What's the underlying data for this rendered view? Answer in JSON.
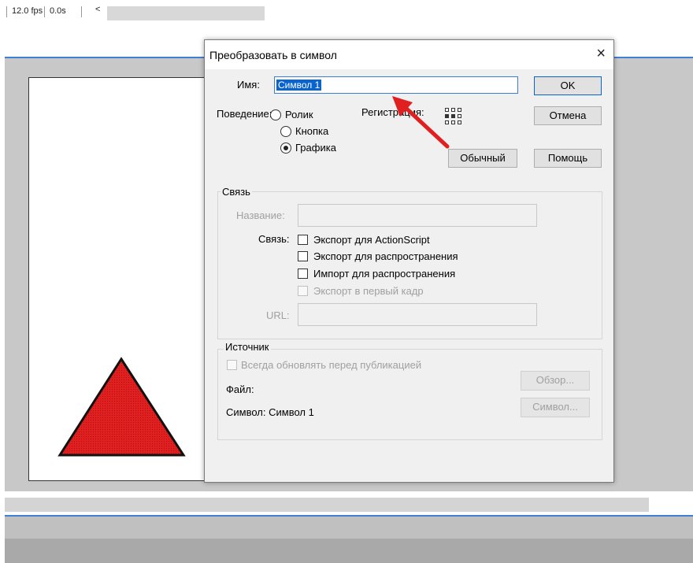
{
  "toolbar": {
    "fps": "12.0 fps",
    "time": "0.0s",
    "scroll_left": "<"
  },
  "dialog": {
    "title": "Преобразовать в символ",
    "close": "×",
    "name_label": "Имя:",
    "name_value": "Символ 1",
    "ok": "OK",
    "cancel": "Отмена",
    "behavior_label": "Поведение:",
    "behaviors": [
      {
        "label": "Ролик",
        "selected": false
      },
      {
        "label": "Кнопка",
        "selected": false
      },
      {
        "label": "Графика",
        "selected": true
      }
    ],
    "registration_label": "Регистрация:",
    "default_btn": "Обычный",
    "help_btn": "Помощь",
    "linkage": {
      "group_title": "Связь",
      "name_label": "Название:",
      "name_value": "",
      "linkage_label": "Связь:",
      "options": [
        {
          "label": "Экспорт для ActionScript",
          "checked": false,
          "disabled": false
        },
        {
          "label": "Экспорт для распространения",
          "checked": false,
          "disabled": false
        },
        {
          "label": "Импорт для распространения",
          "checked": false,
          "disabled": false
        },
        {
          "label": "Экспорт в первый кадр",
          "checked": false,
          "disabled": true
        }
      ],
      "url_label": "URL:",
      "url_value": ""
    },
    "source": {
      "group_title": "Источник",
      "always_update": "Всегда обновлять перед публикацией",
      "file_label": "Файл:",
      "browse_btn": "Обзор...",
      "symbol_label": "Символ: Символ 1",
      "symbol_btn": "Символ..."
    }
  },
  "colors": {
    "accent": "#0a64d0",
    "triangle_fill": "#e02020",
    "arrow": "#e02020",
    "panel_border": "#3f7fd4"
  }
}
